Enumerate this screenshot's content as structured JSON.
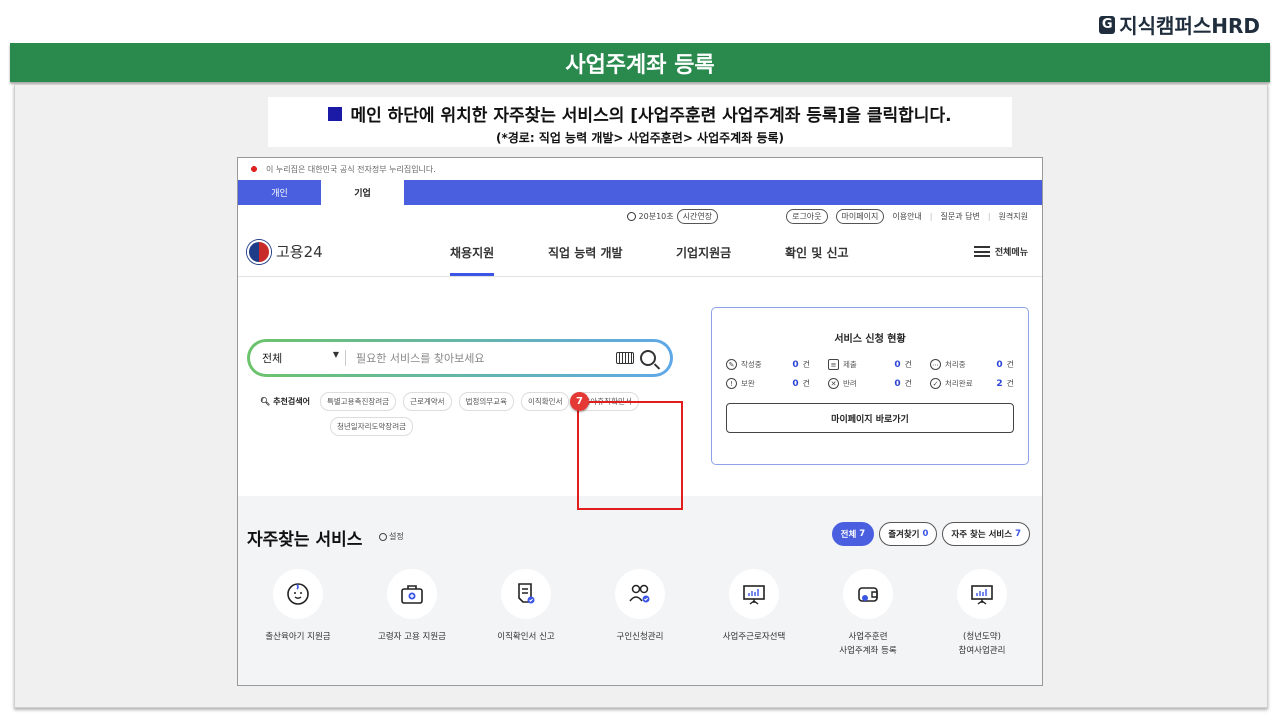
{
  "brand": {
    "mark": "G",
    "name": "지식캠퍼스HRD"
  },
  "slide_title": "사업주계좌 등록",
  "instruction": {
    "main": "메인 하단에 위치한 자주찾는 서비스의 [사업주훈련 사업주계좌 등록]을 클릭합니다.",
    "path": "(*경로: 직업 능력 개발> 사업주훈련> 사업주계좌 등록)"
  },
  "site": {
    "gov_notice": "이 누리집은 대한민국 공식 전자정부 누리집입니다.",
    "user_tabs": [
      "개인",
      "기업"
    ],
    "utility": {
      "session_time": "20분10초",
      "extend": "시간연장",
      "logout": "로그아웃",
      "mypage": "마이페이지",
      "guide": "이용안내",
      "qna": "질문과 답변",
      "remote": "원격지원"
    },
    "logo_text": "고용24",
    "nav": [
      "채용지원",
      "직업 능력 개발",
      "기업지원금",
      "확인 및 신고"
    ],
    "all_menu": "전체메뉴",
    "search": {
      "scope": "전체",
      "placeholder": "필요한 서비스를 찾아보세요"
    },
    "recommend": {
      "label": "추천검색어",
      "chips": [
        "특별고용촉진장려금",
        "근로계약서",
        "법정의무교육",
        "이직확인서",
        "육아휴직확인서",
        "청년일자리도약장려금"
      ]
    },
    "status": {
      "title": "서비스 신청 현황",
      "items": [
        {
          "label": "작성중",
          "count": "0",
          "icon": "pencil-icon"
        },
        {
          "label": "제출",
          "count": "0",
          "icon": "doc-icon"
        },
        {
          "label": "처리중",
          "count": "0",
          "icon": "dots-icon"
        },
        {
          "label": "보완",
          "count": "0",
          "icon": "exclaim-icon"
        },
        {
          "label": "반려",
          "count": "0",
          "icon": "x-icon"
        },
        {
          "label": "처리완료",
          "count": "2",
          "icon": "check-icon"
        }
      ],
      "unit": "건",
      "mypage_button": "마이페이지 바로가기"
    },
    "favorites": {
      "title": "자주찾는 서비스",
      "setting": "설정",
      "filters": [
        {
          "label": "전체",
          "count": "7"
        },
        {
          "label": "즐겨찾기",
          "count": "0"
        },
        {
          "label": "자주 찾는 서비스",
          "count": "7"
        }
      ],
      "services": [
        {
          "line1": "출산육아기 지원금",
          "line2": ""
        },
        {
          "line1": "고령자 고용 지원금",
          "line2": ""
        },
        {
          "line1": "이직확인서 신고",
          "line2": ""
        },
        {
          "line1": "구인신청관리",
          "line2": ""
        },
        {
          "line1": "사업주근로자선택",
          "line2": ""
        },
        {
          "line1": "사업주훈련",
          "line2": "사업주계좌 등록"
        },
        {
          "line1": "(청년도약)",
          "line2": "참여사업관리"
        }
      ]
    },
    "step_number": "7"
  },
  "colors": {
    "title_green": "#2a8a4e",
    "nav_blue": "#4a5fe0",
    "highlight_red": "#e21d1d"
  }
}
